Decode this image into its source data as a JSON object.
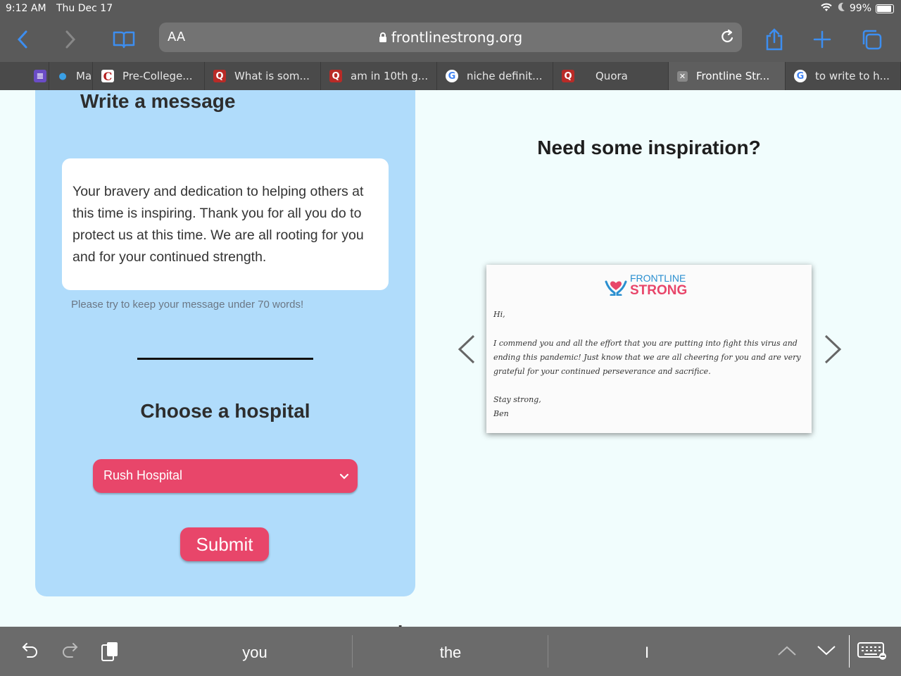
{
  "status": {
    "time": "9:12 AM",
    "date": "Thu Dec 17",
    "battery": "99%",
    "battery_level": 0.99
  },
  "toolbar": {
    "text_size": "AA",
    "url": "frontlinestrong.org"
  },
  "tabs": [
    {
      "icon": "extension-icon",
      "label": ""
    },
    {
      "icon": "drupal-icon",
      "label": "Ma"
    },
    {
      "icon": "c-icon",
      "label": "Pre-College..."
    },
    {
      "icon": "quora-icon",
      "label": "What is som..."
    },
    {
      "icon": "quora-icon",
      "label": "am in 10th g..."
    },
    {
      "icon": "google-icon",
      "label": "niche definit..."
    },
    {
      "icon": "quora-icon",
      "label": "Quora"
    },
    {
      "icon": "close-icon",
      "label": "Frontline Str..."
    },
    {
      "icon": "google-icon",
      "label": "to write to h..."
    }
  ],
  "form": {
    "heading": "Write a message",
    "message": "Your bravery and dedication to helping others at this time is inspiring. Thank you for all you do to protect us at this time. We are all rooting for you and for your continued strength.",
    "hint": "Please try to keep your message under 70 words!",
    "hospital_heading": "Choose a hospital",
    "hospital_selected": "Rush Hospital",
    "submit_label": "Submit"
  },
  "inspiration": {
    "heading": "Need some inspiration?",
    "logo_line1": "FRONTLINE",
    "logo_line2": "STRONG",
    "greeting": "Hi,",
    "body": "I commend you and all the effort that you are putting into fight this virus and ending this pandemic! Just know that we are all cheering for you and are very grateful for your continued perseverance and sacrifice.",
    "closing": "Stay strong,",
    "signature": "Ben"
  },
  "footer": {
    "learn_more": "Learn more"
  },
  "keyboard": {
    "suggestions": [
      "you",
      "the",
      "I"
    ]
  },
  "colors": {
    "accent": "#e8466a",
    "panel": "#b0dcfb",
    "chrome": "#5a5a5a"
  }
}
